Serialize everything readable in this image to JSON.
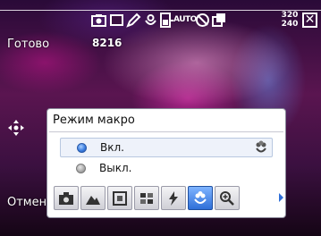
{
  "status_bar": {
    "icons": [
      "camera-icon",
      "frame-icon",
      "pen-icon",
      "macro-icon",
      "battery-icon",
      "auto-iso-icon",
      "timer-off-icon",
      "burst-icon"
    ],
    "auto_label": "AUTO",
    "resolution_top": "320",
    "resolution_bottom": "240",
    "close_symbol": "✕"
  },
  "viewfinder": {
    "ready_label": "Готово",
    "shots_remaining": "8216",
    "cancel_label": "Отмена"
  },
  "dialog": {
    "title": "Режим макро",
    "options": [
      {
        "label": "Вкл.",
        "selected": true,
        "icon": "macro-icon"
      },
      {
        "label": "Выкл.",
        "selected": false
      }
    ]
  },
  "scene_bar": {
    "buttons": [
      {
        "icon": "camera-icon",
        "selected": false
      },
      {
        "icon": "landscape-icon",
        "selected": false
      },
      {
        "icon": "focus-frame-icon",
        "selected": false
      },
      {
        "icon": "grid-icon",
        "selected": false
      },
      {
        "icon": "flash-icon",
        "selected": false
      },
      {
        "icon": "macro-icon",
        "selected": true
      },
      {
        "icon": "zoom-icon",
        "selected": false
      }
    ],
    "next_icon": "chevron-right-icon"
  },
  "colors": {
    "accent": "#2f6fd8",
    "dialog_bg": "#ffffff",
    "text_light": "#ffffff"
  }
}
